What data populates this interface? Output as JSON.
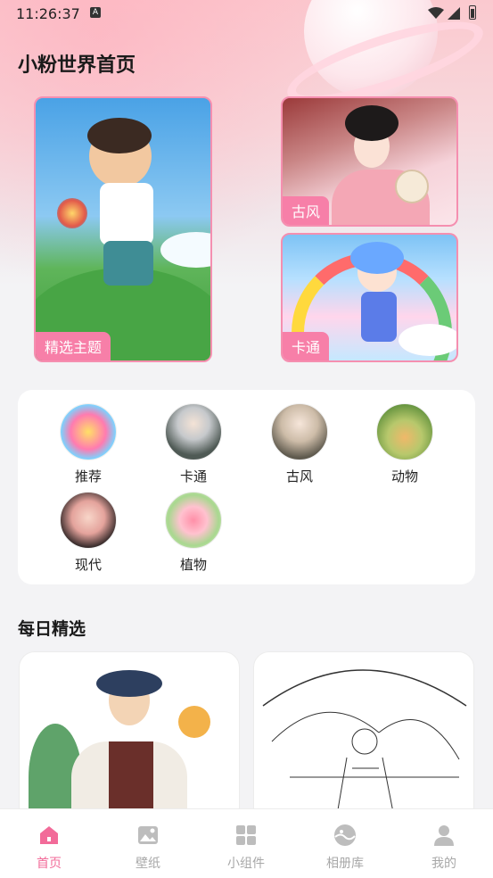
{
  "status": {
    "time": "11:26:37",
    "a_badge": "A"
  },
  "page_title": "小粉世界首页",
  "featured_cards": [
    {
      "label": "精选主题"
    },
    {
      "label": "古风"
    },
    {
      "label": "卡通"
    }
  ],
  "categories": [
    {
      "label": "推荐",
      "color": "#f2c94c"
    },
    {
      "label": "卡通",
      "color": "#8aa0a8"
    },
    {
      "label": "古风",
      "color": "#c9b9a6"
    },
    {
      "label": "动物",
      "color": "#8fb35b"
    },
    {
      "label": "现代",
      "color": "#e7a8a2"
    },
    {
      "label": "植物",
      "color": "#f6b6c4"
    }
  ],
  "section_title": "每日精选",
  "tabbar": {
    "items": [
      {
        "label": "首页",
        "icon": "home-icon",
        "active": true
      },
      {
        "label": "壁纸",
        "icon": "image-icon",
        "active": false
      },
      {
        "label": "小组件",
        "icon": "widgets-icon",
        "active": false
      },
      {
        "label": "相册库",
        "icon": "album-icon",
        "active": false
      },
      {
        "label": "我的",
        "icon": "user-icon",
        "active": false
      }
    ]
  },
  "colors": {
    "accent": "#f26b99",
    "card_border": "#f58fb0",
    "label_bg": "#f77fa8"
  }
}
